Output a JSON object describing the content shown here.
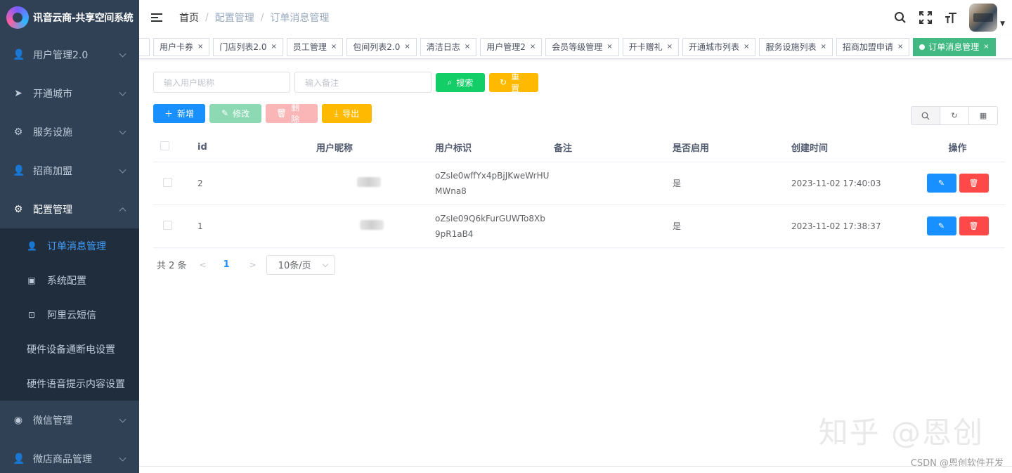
{
  "app": {
    "title": "讯音云商-共享空间系统"
  },
  "sidebar": {
    "items": [
      {
        "label": "用户管理2.0",
        "icon": "user-icon",
        "glyph": "👤"
      },
      {
        "label": "开通城市",
        "icon": "send-icon",
        "glyph": "➤"
      },
      {
        "label": "服务设施",
        "icon": "gear-icon",
        "glyph": "⚙"
      },
      {
        "label": "招商加盟",
        "icon": "user-icon",
        "glyph": "👤"
      },
      {
        "label": "配置管理",
        "icon": "gear-icon",
        "glyph": "⚙"
      }
    ],
    "submenu": [
      {
        "label": "订单消息管理",
        "icon": "user-icon",
        "glyph": "👤"
      },
      {
        "label": "系统配置",
        "icon": "box-icon",
        "glyph": "▣"
      },
      {
        "label": "阿里云短信",
        "icon": "briefcase-icon",
        "glyph": "⊡"
      },
      {
        "label": "硬件设备通断电设置"
      },
      {
        "label": "硬件语音提示内容设置"
      }
    ],
    "bottom_items": [
      {
        "label": "微信管理",
        "icon": "wechat-icon",
        "glyph": "◉"
      },
      {
        "label": "微店商品管理",
        "icon": "user-icon",
        "glyph": "👤"
      }
    ]
  },
  "breadcrumb": {
    "home": "首页",
    "parent": "配置管理",
    "current": "订单消息管理",
    "sep": "/"
  },
  "tags": [
    "用户卡券",
    "门店列表2.0",
    "员工管理",
    "包间列表2.0",
    "清洁日志",
    "用户管理2",
    "会员等级管理",
    "开卡赠礼",
    "开通城市列表",
    "服务设施列表",
    "招商加盟申请"
  ],
  "active_tag": "订单消息管理",
  "search": {
    "nickname_placeholder": "输入用户昵称",
    "remark_placeholder": "输入备注",
    "search_label": "搜索",
    "reset_label": "重置"
  },
  "toolbar": {
    "add": "新增",
    "edit": "修改",
    "delete": "删除",
    "export": "导出"
  },
  "table": {
    "columns": [
      "id",
      "用户昵称",
      "用户标识",
      "备注",
      "是否启用",
      "创建时间",
      "操作"
    ],
    "rows": [
      {
        "id": "2",
        "ident_line1": "oZsIe0wffYx4pBjJKweWrHU",
        "ident_line2": "MWna8",
        "remark": "",
        "enabled": "是",
        "created": "2023-11-02 17:40:03"
      },
      {
        "id": "1",
        "ident_line1": "oZsIe09Q6kFurGUWTo8Xb",
        "ident_line2": "9pR1aB4",
        "remark": "",
        "enabled": "是",
        "created": "2023-11-02 17:38:37"
      }
    ]
  },
  "pagination": {
    "total": "共 2 条",
    "page": "1",
    "page_size": "10条/页"
  },
  "watermark": {
    "main": "知乎 @恩创",
    "sub": "CSDN @恩创软件开发"
  },
  "colors": {
    "sidebar_bg": "#304156",
    "active_tag": "#42b983",
    "primary": "#1890ff",
    "success": "#13ce66",
    "warning": "#ffba00",
    "danger": "#ff4949"
  }
}
